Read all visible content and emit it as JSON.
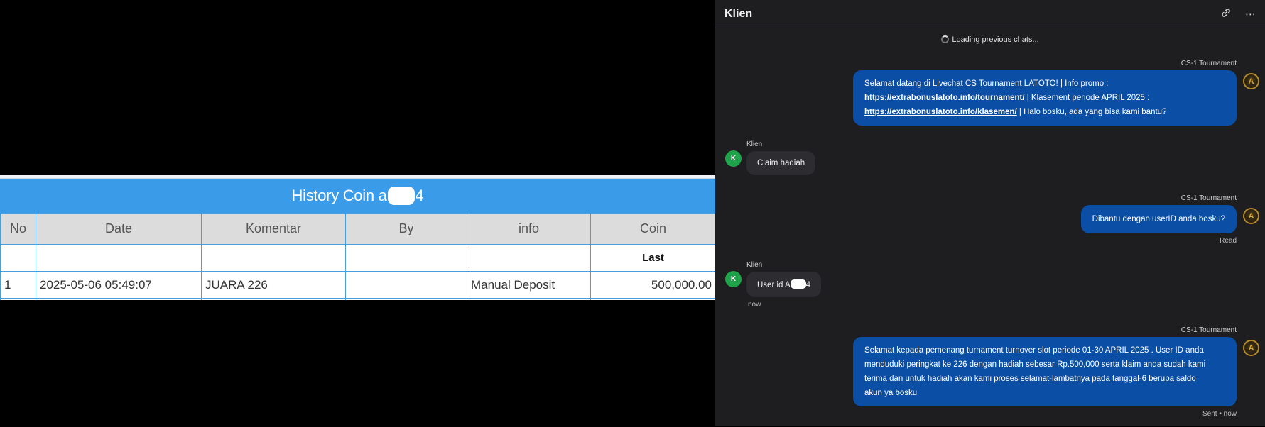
{
  "history": {
    "title_prefix": "History Coin a",
    "title_suffix": "4",
    "headers": [
      "No",
      "Date",
      "Komentar",
      "By",
      "info",
      "Coin"
    ],
    "sub_label": "Last",
    "rows": [
      {
        "no": "1",
        "date": "2025-05-06 05:49:07",
        "komentar": "JUARA 226",
        "by": "",
        "info": "Manual Deposit",
        "coin": "500,000.00"
      }
    ],
    "colors": {
      "header_bar": "#3a9be8",
      "coin_value": "#2e8b2e"
    }
  },
  "chat": {
    "title": "Klien",
    "icons": {
      "link": "link-icon",
      "more": "more-icon"
    },
    "loading_text": "Loading previous chats...",
    "messages": [
      {
        "from": "agent",
        "sender": "CS-1 Tournament",
        "parts": [
          "Selamat datang di Livechat CS Tournament LATOTO! | Info promo :",
          "https://extrabonuslatoto.info/tournament/",
          " | Klasement periode APRIL 2025 :",
          "https://extrabonuslatoto.info/klasemen/",
          " | Halo bosku, ada yang bisa kami bantu?"
        ]
      },
      {
        "from": "client",
        "sender": "Klien",
        "avatar": "K",
        "text": "Claim hadiah"
      },
      {
        "from": "agent",
        "sender": "CS-1 Tournament",
        "text": "Dibantu dengan userID anda bosku?",
        "status": "Read"
      },
      {
        "from": "client",
        "sender": "Klien",
        "avatar": "K",
        "text_prefix": "User id A",
        "text_suffix": "4",
        "time": "now"
      },
      {
        "from": "agent",
        "sender": "CS-1 Tournament",
        "text_lines": [
          "Selamat kepada pemenang turnament turnover slot periode 01-30 APRIL 2025 . User ID anda",
          "menduduki peringkat ke 226 dengan hadiah sebesar Rp.500,000 serta klaim anda sudah kami",
          "terima dan untuk hadiah akan kami proses selamat-lambatnya pada tanggal-6 berupa saldo",
          "akun ya bosku"
        ],
        "status": "Sent • now"
      }
    ],
    "colors": {
      "panel_bg": "#1e1e21",
      "agent_bubble": "#0b4ea6",
      "client_bubble": "#2c2c31",
      "client_avatar": "#1fa34a"
    }
  }
}
